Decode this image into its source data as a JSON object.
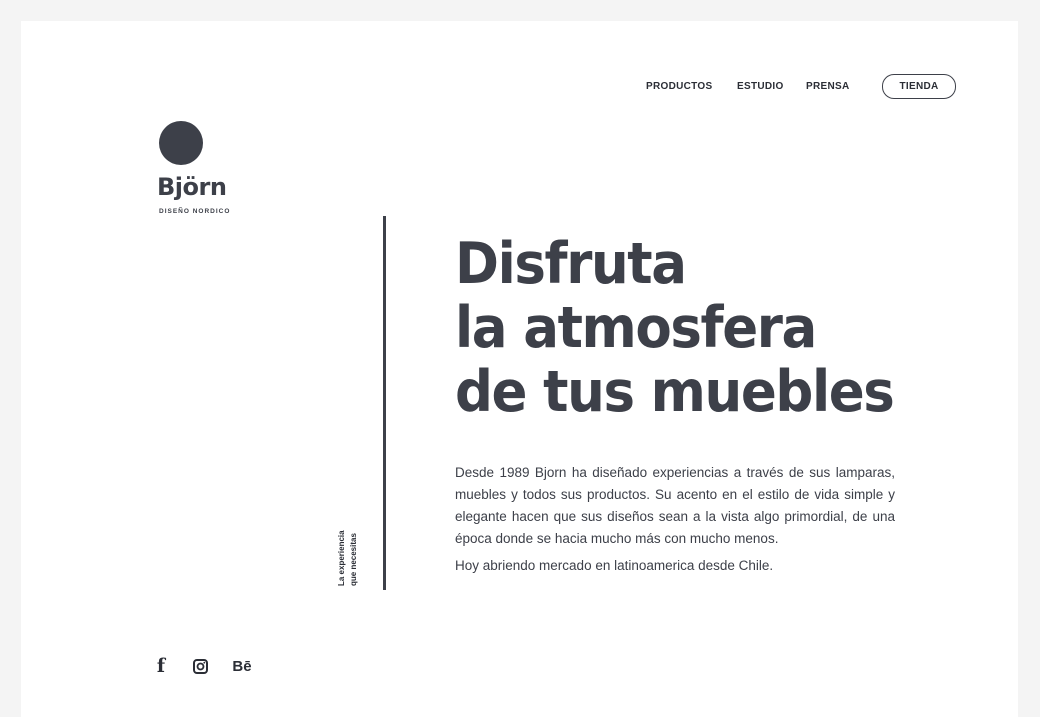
{
  "nav": {
    "items": [
      {
        "label": "PRODUCTOS"
      },
      {
        "label": "ESTUDIO"
      },
      {
        "label": "PRENSA"
      }
    ],
    "shop_label": "TIENDA"
  },
  "brand": {
    "name": "Björn",
    "tagline": "DISEÑO NORDICO"
  },
  "side_caption": {
    "line1": "La experiencia",
    "line2": "que necesitas"
  },
  "hero": {
    "headline_lines": [
      "Disfruta",
      "la atmosfera",
      "de tus muebles"
    ],
    "paragraph": "Desde 1989 Bjorn ha diseñado experiencias a través de sus lamparas, muebles y todos sus productos. Su acento en el estilo de vida simple y elegante hacen que sus diseños sean a la vista algo primordial, de  una época donde se hacia mucho más con mucho menos.",
    "paragraph2": "Hoy abriendo mercado en latinoamerica desde Chile."
  },
  "social": {
    "facebook": {
      "icon": "facebook-icon",
      "glyph": "f"
    },
    "instagram": {
      "icon": "instagram-icon"
    },
    "behance": {
      "icon": "behance-icon",
      "glyph": "Bē"
    }
  },
  "colors": {
    "background": "#f4f4f4",
    "page": "#ffffff",
    "ink": "#3d4049"
  }
}
